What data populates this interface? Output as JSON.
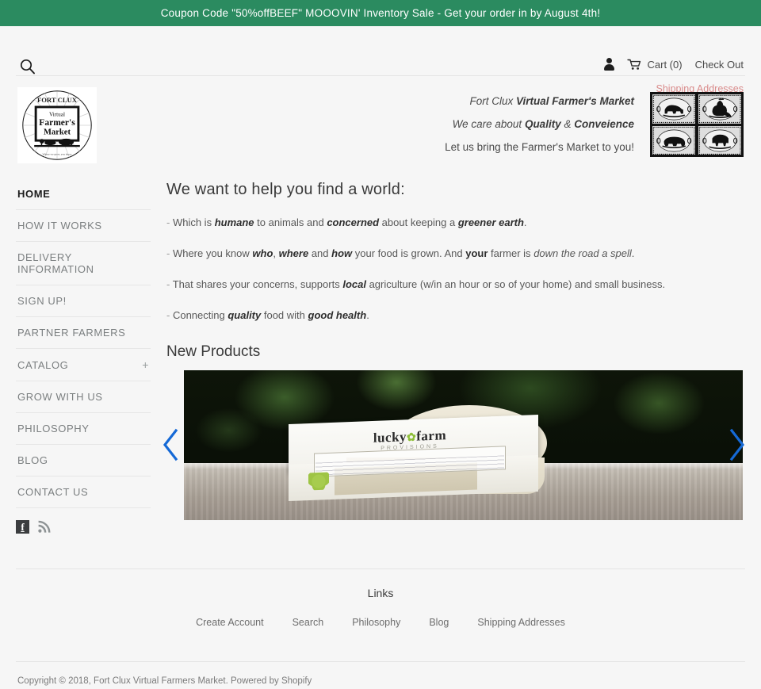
{
  "announcement": {
    "text": "Coupon Code \"50%offBEEF\" MOOOVIN' Inventory Sale - Get your order in by August 4th!",
    "background_color": "#2b8b60"
  },
  "topbar": {
    "search_icon": "search-icon",
    "account_icon": "person-icon",
    "cart_icon": "cart-icon",
    "cart_label": "Cart (0)",
    "checkout_label": "Check Out",
    "shipping_addresses_label": "Shipping Addresses",
    "shipping_link_color": "#d98b8b"
  },
  "masthead": {
    "logo_alt": "Fort Clux Virtual Farmer's Market",
    "logo_top_text": "FORT CLUX",
    "logo_line1": "Virtual",
    "logo_line2": "Farmer's",
    "logo_line3": "Market",
    "tagline": {
      "line1_plain": "Fort Clux ",
      "line1_bold": "Virtual Farmer's Market",
      "line2_plain": "We care about ",
      "line2_bold1": "Quality",
      "line2_amp": " & ",
      "line2_bold2": "Conveience",
      "line3": "Let us bring the Farmer's Market to you!"
    },
    "stamps": [
      "cow-stamp",
      "rooster-stamp",
      "pig-stamp",
      "sheep-stamp"
    ]
  },
  "sidebar": {
    "items": [
      {
        "label": "HOME",
        "active": true,
        "expandable": false
      },
      {
        "label": "HOW IT WORKS",
        "active": false,
        "expandable": false
      },
      {
        "label": "DELIVERY INFORMATION",
        "active": false,
        "expandable": false
      },
      {
        "label": "SIGN UP!",
        "active": false,
        "expandable": false
      },
      {
        "label": "PARTNER FARMERS",
        "active": false,
        "expandable": false
      },
      {
        "label": "CATALOG",
        "active": false,
        "expandable": true,
        "expander": "+"
      },
      {
        "label": "GROW WITH US",
        "active": false,
        "expandable": false
      },
      {
        "label": "PHILOSOPHY",
        "active": false,
        "expandable": false
      },
      {
        "label": "BLOG",
        "active": false,
        "expandable": false
      },
      {
        "label": "CONTACT US",
        "active": false,
        "expandable": false
      }
    ],
    "social": [
      {
        "name": "facebook-icon",
        "glyph": "f"
      },
      {
        "name": "rss-icon",
        "glyph": ""
      }
    ]
  },
  "main": {
    "headline": "We want to help you find a world:",
    "bullets": [
      {
        "dash": "-",
        "parts": [
          {
            "t": "Which is ",
            "s": "plain"
          },
          {
            "t": "humane",
            "s": "bolditalic"
          },
          {
            "t": " to animals and ",
            "s": "plain"
          },
          {
            "t": "concerned",
            "s": "bolditalic"
          },
          {
            "t": " about keeping a ",
            "s": "plain"
          },
          {
            "t": "greener earth",
            "s": "bolditalic"
          },
          {
            "t": ".",
            "s": "plain"
          }
        ]
      },
      {
        "dash": "-",
        "parts": [
          {
            "t": "Where you know ",
            "s": "plain"
          },
          {
            "t": "who",
            "s": "bolditalic"
          },
          {
            "t": ", ",
            "s": "plain"
          },
          {
            "t": "where",
            "s": "bolditalic"
          },
          {
            "t": " and ",
            "s": "plain"
          },
          {
            "t": "how",
            "s": "bolditalic"
          },
          {
            "t": " your food is grown. And ",
            "s": "plain"
          },
          {
            "t": "your",
            "s": "bold"
          },
          {
            "t": " farmer is ",
            "s": "plain"
          },
          {
            "t": "down the road a spell",
            "s": "italic"
          },
          {
            "t": ".",
            "s": "plain"
          }
        ]
      },
      {
        "dash": "-",
        "parts": [
          {
            "t": "That shares your concerns, supports ",
            "s": "plain"
          },
          {
            "t": "local",
            "s": "bolditalic"
          },
          {
            "t": " agriculture (w/in an hour or so of your home) and small business.",
            "s": "plain"
          }
        ]
      },
      {
        "dash": "-",
        "parts": [
          {
            "t": "Connecting ",
            "s": "plain"
          },
          {
            "t": "quality",
            "s": "bolditalic"
          },
          {
            "t": " food with ",
            "s": "plain"
          },
          {
            "t": "good health",
            "s": "bolditalic"
          },
          {
            "t": ".",
            "s": "plain"
          }
        ]
      }
    ],
    "section_title": "New Products",
    "carousel": {
      "prev_label": "‹",
      "next_label": "›",
      "arrow_color": "#1569d6",
      "slide_alt": "lucky farm provisions soap bar",
      "product_brand_left": "lucky",
      "product_brand_right": "farm",
      "product_brand_sub": "PROVISIONS"
    }
  },
  "footer": {
    "links_heading": "Links",
    "links": [
      "Create Account",
      "Search",
      "Philosophy",
      "Blog",
      "Shipping Addresses"
    ],
    "copyright": "Copyright © 2018, Fort Clux Virtual Farmers Market. Powered by Shopify"
  }
}
